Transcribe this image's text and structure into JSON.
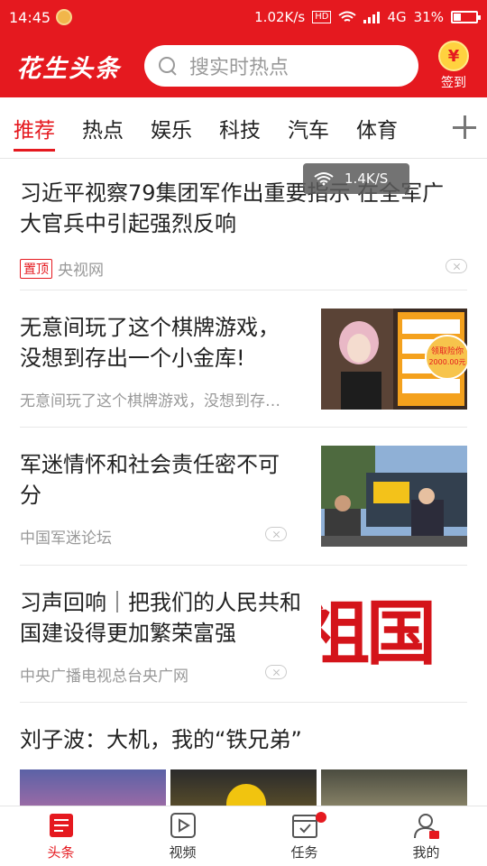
{
  "status_bar": {
    "time": "14:45",
    "network_speed": "1.02K/s",
    "hd": "HD",
    "network_type": "4G",
    "battery": "31%"
  },
  "header": {
    "logo": "花生头条",
    "search_placeholder": "搜实时热点",
    "signin_label": "签到",
    "coin_symbol": "¥"
  },
  "tabs": [
    {
      "label": "推荐",
      "active": true
    },
    {
      "label": "热点"
    },
    {
      "label": "娱乐"
    },
    {
      "label": "科技"
    },
    {
      "label": "汽车"
    },
    {
      "label": "体育"
    }
  ],
  "toast": {
    "speed": "1.4K/S"
  },
  "feed": {
    "item1": {
      "title": "习近平视察79集团军作出重要指示 在全军广大官兵中引起强烈反响",
      "tag": "置顶",
      "source": "央视网"
    },
    "item2": {
      "title": "无意间玩了这个棋牌游戏，没想到存出一个小金库!",
      "summary": "无意间玩了这个棋牌游戏，没想到存…",
      "thumb_text": "领取险你 2000.00元"
    },
    "item3": {
      "title": "军迷情怀和社会责任密不可分",
      "source": "中国军迷论坛"
    },
    "item4": {
      "title": "习声回响｜把我们的人民共和国建设得更加繁荣富强",
      "source": "中央广播电视总台央广网",
      "thumb_text": "祖国"
    },
    "item5": {
      "title": "刘子波：大机，我的“铁兄弟”"
    }
  },
  "bottom_nav": [
    {
      "label": "头条",
      "icon": "news-icon",
      "active": true
    },
    {
      "label": "视频",
      "icon": "video-icon"
    },
    {
      "label": "任务",
      "icon": "task-icon",
      "badge": true
    },
    {
      "label": "我的",
      "icon": "profile-icon"
    }
  ],
  "colors": {
    "brand": "#e5191f"
  }
}
